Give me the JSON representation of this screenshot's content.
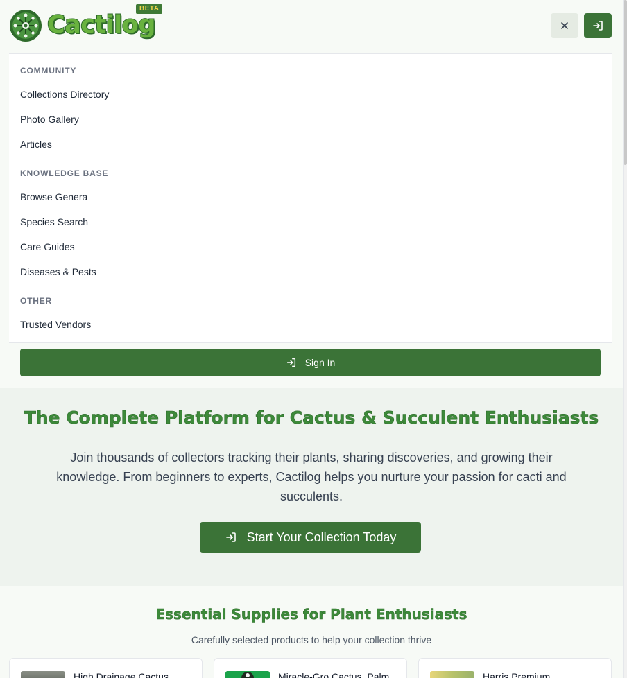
{
  "header": {
    "brand": "Cactilog",
    "badge": "BETA",
    "brand_color": "#69b23f",
    "accent_color": "#3b7337"
  },
  "nav": {
    "sections": [
      {
        "title": "COMMUNITY",
        "items": [
          "Collections Directory",
          "Photo Gallery",
          "Articles"
        ]
      },
      {
        "title": "KNOWLEDGE BASE",
        "items": [
          "Browse Genera",
          "Species Search",
          "Care Guides",
          "Diseases & Pests"
        ]
      },
      {
        "title": "OTHER",
        "items": [
          "Trusted Vendors"
        ]
      }
    ],
    "signin_label": "Sign In"
  },
  "hero": {
    "title": "The Complete Platform for Cactus & Succulent Enthusiasts",
    "description": "Join thousands of collectors tracking their plants, sharing discoveries, and growing their knowledge. From beginners to experts, Cactilog helps you nurture your passion for cacti and succulents.",
    "cta_label": "Start Your Collection Today"
  },
  "supplies": {
    "title": "Essential Supplies for Plant Enthusiasts",
    "subtitle": "Carefully selected products to help your collection thrive",
    "products": [
      {
        "name": "High Drainage Cactus"
      },
      {
        "name": "Miracle-Gro Cactus, Palm"
      },
      {
        "name": "Harris Premium"
      }
    ]
  },
  "icons": {
    "close": "close-icon",
    "signin": "sign-in-icon",
    "logo": "cactus-logo-icon"
  }
}
